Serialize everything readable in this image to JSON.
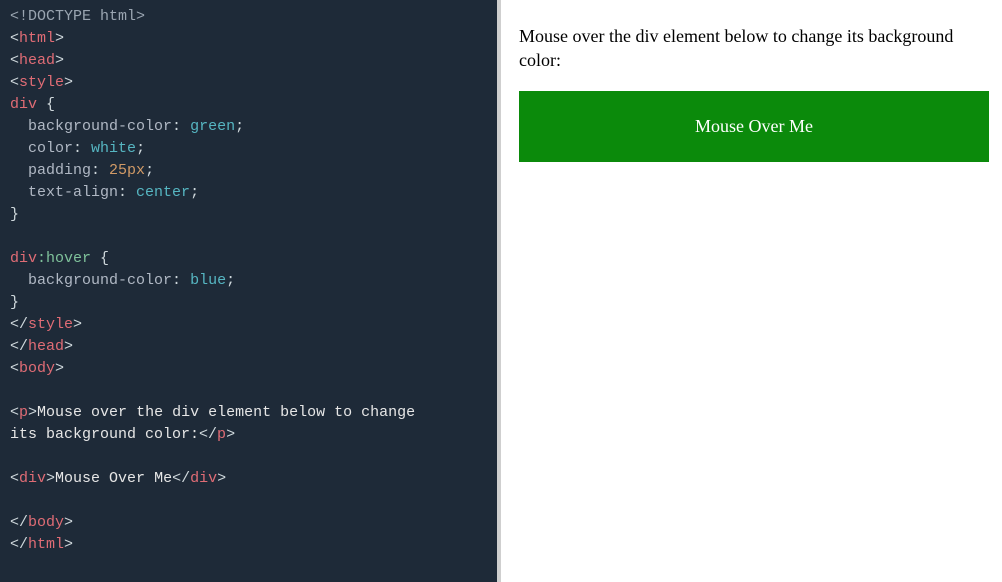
{
  "code": {
    "l1_a": "<!",
    "l1_b": "DOCTYPE html",
    "l1_c": ">",
    "open": "<",
    "close": ">",
    "openend": "</",
    "tag_html": "html",
    "tag_head": "head",
    "tag_style": "style",
    "sel_div": "div",
    "brace_open": " {",
    "brace_close": "}",
    "indent": "  ",
    "prop_bg": "background-color",
    "colon": ": ",
    "semicolon": ";",
    "val_green": "green",
    "prop_color": "color",
    "val_white": "white",
    "prop_padding": "padding",
    "val_25px": "25px",
    "prop_textalign": "text-align",
    "val_center": "center",
    "sel_divhover_a": "div",
    "sel_divhover_b": ":hover",
    "val_blue": "blue",
    "tag_body": "body",
    "tag_p": "p",
    "ptext_a": "Mouse over the div element below to change ",
    "ptext_b": "its background color:",
    "tag_div": "div",
    "divtext": "Mouse Over Me"
  },
  "preview": {
    "paragraph": "Mouse over the div element below to change its background color:",
    "box_label": "Mouse Over Me"
  }
}
